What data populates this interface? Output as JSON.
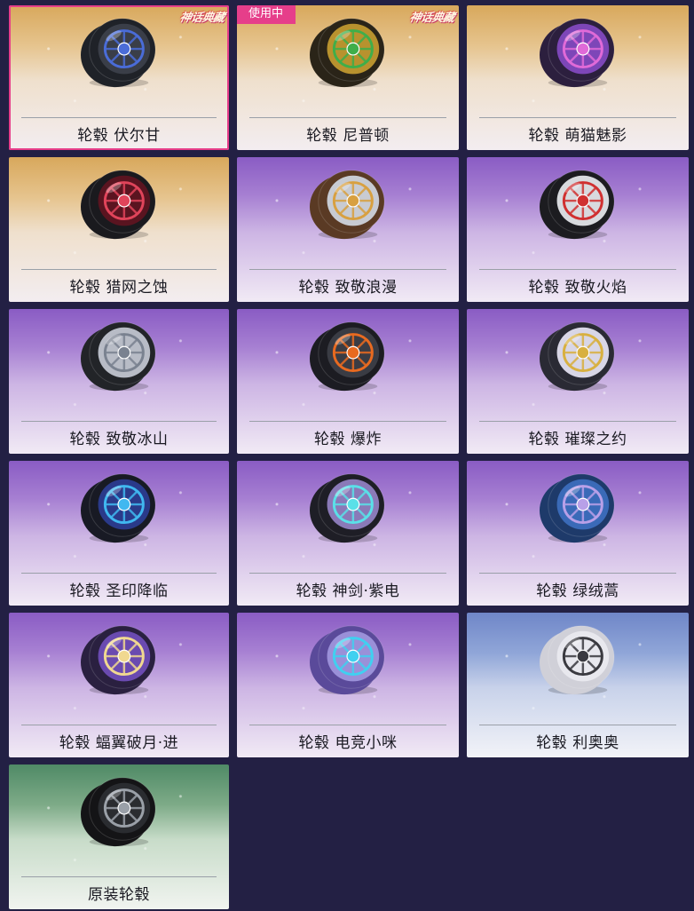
{
  "items": [
    {
      "label": "轮毂 伏尔甘",
      "theme": "gold",
      "selected": true,
      "series_badge": "神话典藏",
      "inuse_badge": "",
      "rim_color": "#3a3e48",
      "accent_color": "#4a6cd8",
      "tire_color": "#1f2228"
    },
    {
      "label": "轮毂 尼普顿",
      "theme": "gold",
      "selected": false,
      "series_badge": "神话典藏",
      "inuse_badge": "使用中",
      "rim_color": "#b8922e",
      "accent_color": "#3fae4a",
      "tire_color": "#2a2418"
    },
    {
      "label": "轮毂 萌猫魅影",
      "theme": "gold",
      "selected": false,
      "series_badge": "",
      "inuse_badge": "",
      "rim_color": "#7d46b8",
      "accent_color": "#e06ad8",
      "tire_color": "#2c1f3e"
    },
    {
      "label": "轮毂 猎网之蚀",
      "theme": "gold",
      "selected": false,
      "series_badge": "",
      "inuse_badge": "",
      "rim_color": "#5a1420",
      "accent_color": "#e0445a",
      "tire_color": "#1a1a1e"
    },
    {
      "label": "轮毂 致敬浪漫",
      "theme": "purple",
      "selected": false,
      "series_badge": "",
      "inuse_badge": "",
      "rim_color": "#c8cbd2",
      "accent_color": "#d8a040",
      "tire_color": "#5a3a24"
    },
    {
      "label": "轮毂 致敬火焰",
      "theme": "purple",
      "selected": false,
      "series_badge": "",
      "inuse_badge": "",
      "rim_color": "#d8dade",
      "accent_color": "#d03030",
      "tire_color": "#1c1c20"
    },
    {
      "label": "轮毂 致敬冰山",
      "theme": "purple",
      "selected": false,
      "series_badge": "",
      "inuse_badge": "",
      "rim_color": "#b8bcc6",
      "accent_color": "#7a8290",
      "tire_color": "#222428"
    },
    {
      "label": "轮毂 爆炸",
      "theme": "purple",
      "selected": false,
      "series_badge": "",
      "inuse_badge": "",
      "rim_color": "#3a3c44",
      "accent_color": "#e86a20",
      "tire_color": "#1c1c22"
    },
    {
      "label": "轮毂 璀璨之约",
      "theme": "purple",
      "selected": false,
      "series_badge": "",
      "inuse_badge": "",
      "rim_color": "#d8d6e6",
      "accent_color": "#d8b040",
      "tire_color": "#2a2a34"
    },
    {
      "label": "轮毂 圣印降临",
      "theme": "purple",
      "selected": false,
      "series_badge": "",
      "inuse_badge": "",
      "rim_color": "#2a3a8a",
      "accent_color": "#40b8f0",
      "tire_color": "#181a24"
    },
    {
      "label": "轮毂 神剑·紫电",
      "theme": "purple",
      "selected": false,
      "series_badge": "",
      "inuse_badge": "",
      "rim_color": "#8a7ab8",
      "accent_color": "#5ae0e8",
      "tire_color": "#1e1e26"
    },
    {
      "label": "轮毂 绿绒蒿",
      "theme": "purple",
      "selected": false,
      "series_badge": "",
      "inuse_badge": "",
      "rim_color": "#3a6ab8",
      "accent_color": "#b8a0e8",
      "tire_color": "#1e3a6a"
    },
    {
      "label": "轮毂 蝠翼破月·进",
      "theme": "purple",
      "selected": false,
      "series_badge": "",
      "inuse_badge": "",
      "rim_color": "#6a4ab0",
      "accent_color": "#f0d890",
      "tire_color": "#2a2040"
    },
    {
      "label": "轮毂 电竞小咪",
      "theme": "purple",
      "selected": false,
      "series_badge": "",
      "inuse_badge": "",
      "rim_color": "#9a90d8",
      "accent_color": "#40d0f0",
      "tire_color": "#5a4a9a"
    },
    {
      "label": "轮毂 利奥奥",
      "theme": "blue",
      "selected": false,
      "series_badge": "",
      "inuse_badge": "",
      "rim_color": "#e8e8ee",
      "accent_color": "#3a3a40",
      "tire_color": "#d0d0d8"
    },
    {
      "label": "原装轮毂",
      "theme": "green",
      "selected": false,
      "series_badge": "",
      "inuse_badge": "",
      "rim_color": "#2a2c30",
      "accent_color": "#9aa0a8",
      "tire_color": "#141416"
    }
  ]
}
